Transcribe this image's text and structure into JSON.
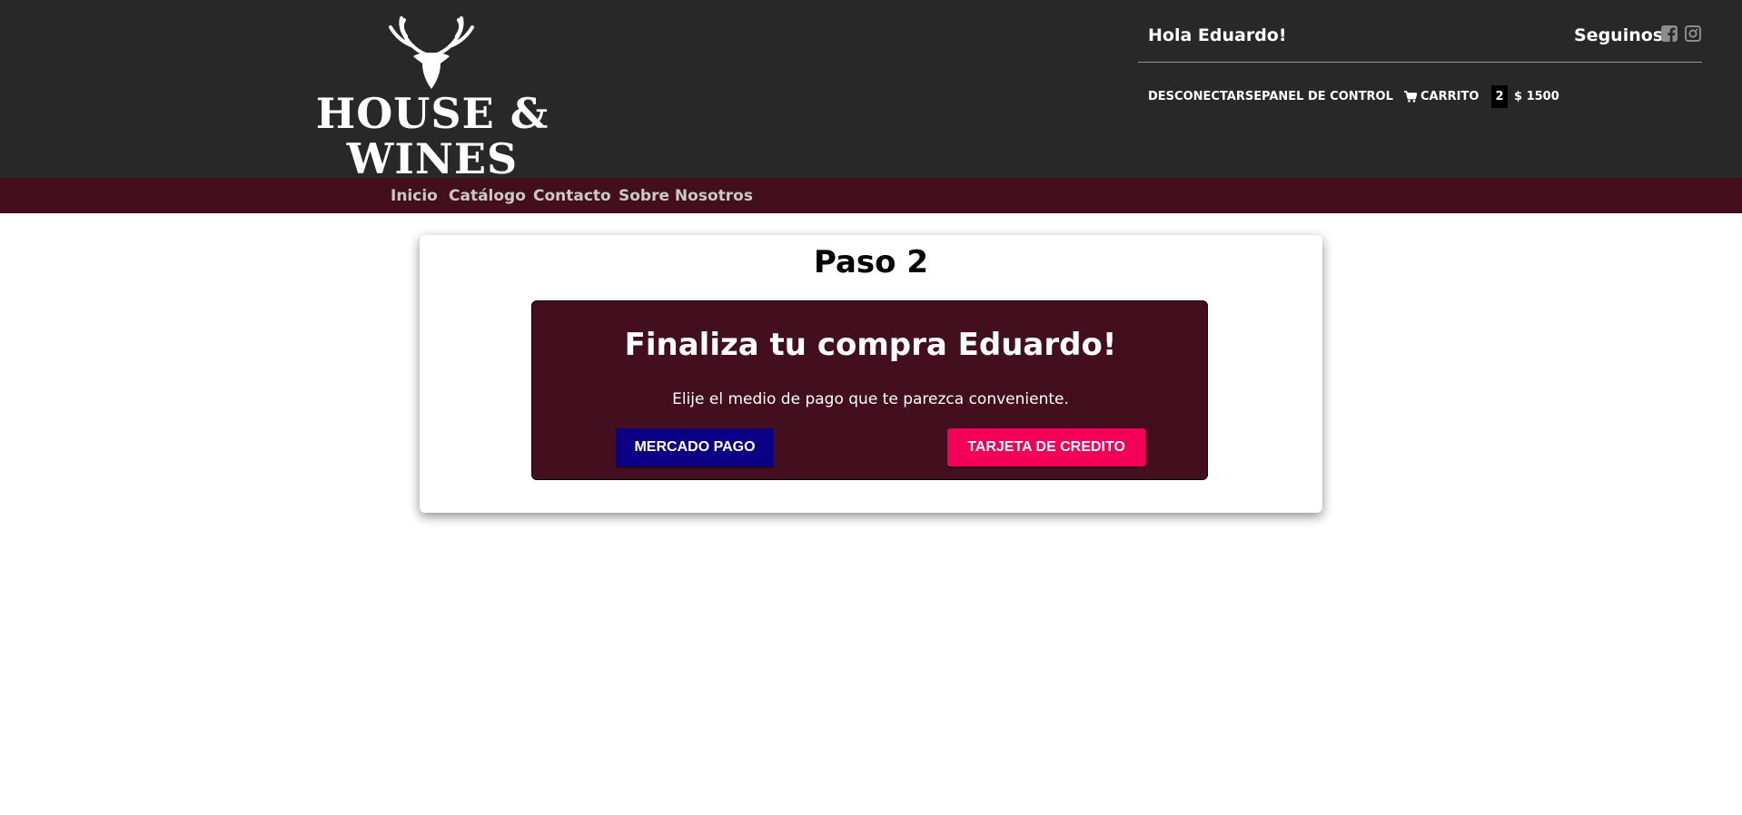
{
  "brand": {
    "name": "HOUSE & WINES",
    "logo_icon": "deer-head-icon"
  },
  "header": {
    "greeting": "Hola Eduardo!",
    "follow_label": "Seguinos",
    "social_icons": [
      "facebook-icon",
      "instagram-icon"
    ],
    "logout_label": "DESCONECTARSE",
    "control_panel_label": "PANEL DE CONTROL",
    "cart_label": "CARRITO",
    "cart_count": "2",
    "cart_total": "$ 1500"
  },
  "nav": {
    "items": [
      {
        "label": "Inicio"
      },
      {
        "label": "Catálogo"
      },
      {
        "label": "Contacto"
      },
      {
        "label": "Sobre Nosotros"
      }
    ]
  },
  "checkout": {
    "step_title": "Paso 2",
    "panel_title": "Finaliza tu compra Eduardo!",
    "panel_subtitle": "Elije el medio de pago que te parezca conveniente.",
    "mercado_pago_label": "MERCADO PAGO",
    "credit_card_label": "TARJETA DE CREDITO"
  },
  "colors": {
    "header_bg": "#282828",
    "nav_bg": "#430f1f",
    "panel_bg": "#430f1f",
    "mercado_pago_btn": "#0b0085",
    "credit_card_btn": "#f50057"
  }
}
